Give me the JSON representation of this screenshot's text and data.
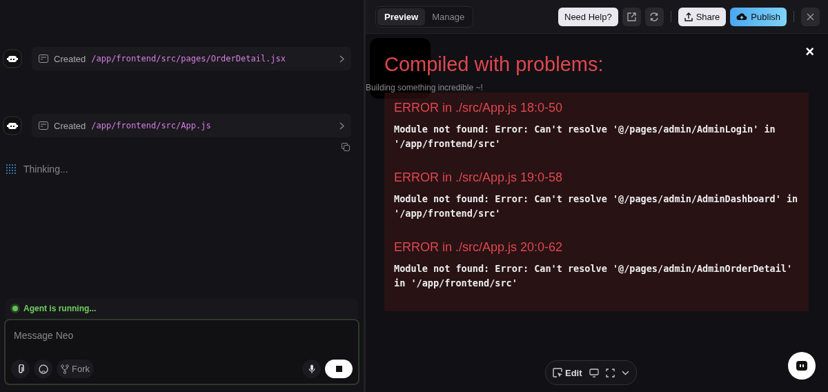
{
  "chat": {
    "messages": [
      {
        "action": "Created",
        "path": "/app/frontend/src/pages/OrderDetail.jsx"
      },
      {
        "action": "Created",
        "path": "/app/frontend/src/App.js"
      }
    ],
    "thinking": "Thinking...",
    "status": "Agent is running...",
    "composer": {
      "placeholder": "Message Neo",
      "fork": "Fork"
    }
  },
  "preview": {
    "tabs": [
      {
        "label": "Preview",
        "selected": true
      },
      {
        "label": "Manage",
        "selected": false
      }
    ],
    "help": "Need Help?",
    "share": "Share",
    "publish": "Publish",
    "loading_text": "Building something incredible ~!",
    "overlay": {
      "title": "Compiled with problems:",
      "close": "×",
      "errors": [
        {
          "heading": "ERROR in ./src/App.js 18:0-50",
          "message": "Module not found: Error: Can't resolve '@/pages/admin/AdminLogin' in '/app/frontend/src'"
        },
        {
          "heading": "ERROR in ./src/App.js 19:0-58",
          "message": "Module not found: Error: Can't resolve '@/pages/admin/AdminDashboard' in '/app/frontend/src'"
        },
        {
          "heading": "ERROR in ./src/App.js 20:0-62",
          "message": "Module not found: Error: Can't resolve '@/pages/admin/AdminOrderDetail' in '/app/frontend/src'"
        }
      ]
    },
    "toolbar": {
      "edit": "Edit"
    }
  }
}
